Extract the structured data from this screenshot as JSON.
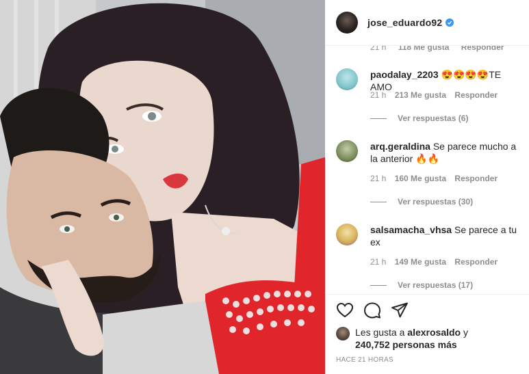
{
  "post": {
    "author": "jose_eduardo92",
    "verified": true,
    "cut_row": {
      "time": "21 h",
      "likes": "118 Me gusta",
      "reply": "Responder"
    }
  },
  "comments": [
    {
      "user": "paodalay_2203",
      "text": "😍😍😍😍TE AMO",
      "time": "21 h",
      "likes": "213 Me gusta",
      "reply": "Responder",
      "replies": "Ver respuestas (6)",
      "avatar_color": "#7fc4c9"
    },
    {
      "user": "arq.geraldina",
      "text": "Se parece mucho a la anterior 🔥🔥",
      "time": "21 h",
      "likes": "160 Me gusta",
      "reply": "Responder",
      "replies": "Ver respuestas (30)",
      "avatar_color": "#7a8c5a"
    },
    {
      "user": "salsamacha_vhsa",
      "text": "Se parece a tu ex",
      "time": "21 h",
      "likes": "149 Me gusta",
      "reply": "Responder",
      "replies": "Ver respuestas (17)",
      "avatar_color": "#d8b25a"
    }
  ],
  "likes": {
    "prefix": "Les gusta a",
    "user": "alexrosaldo",
    "suffix": "y",
    "count": "240,752 personas más"
  },
  "timestamp": "HACE 21 HORAS",
  "icons": [
    "heart-icon",
    "comment-icon",
    "share-icon",
    "bookmark-icon",
    "verified-badge-icon"
  ],
  "colors": {
    "accent": "#3897f0",
    "muted": "#8e8e8e",
    "text": "#262626"
  }
}
